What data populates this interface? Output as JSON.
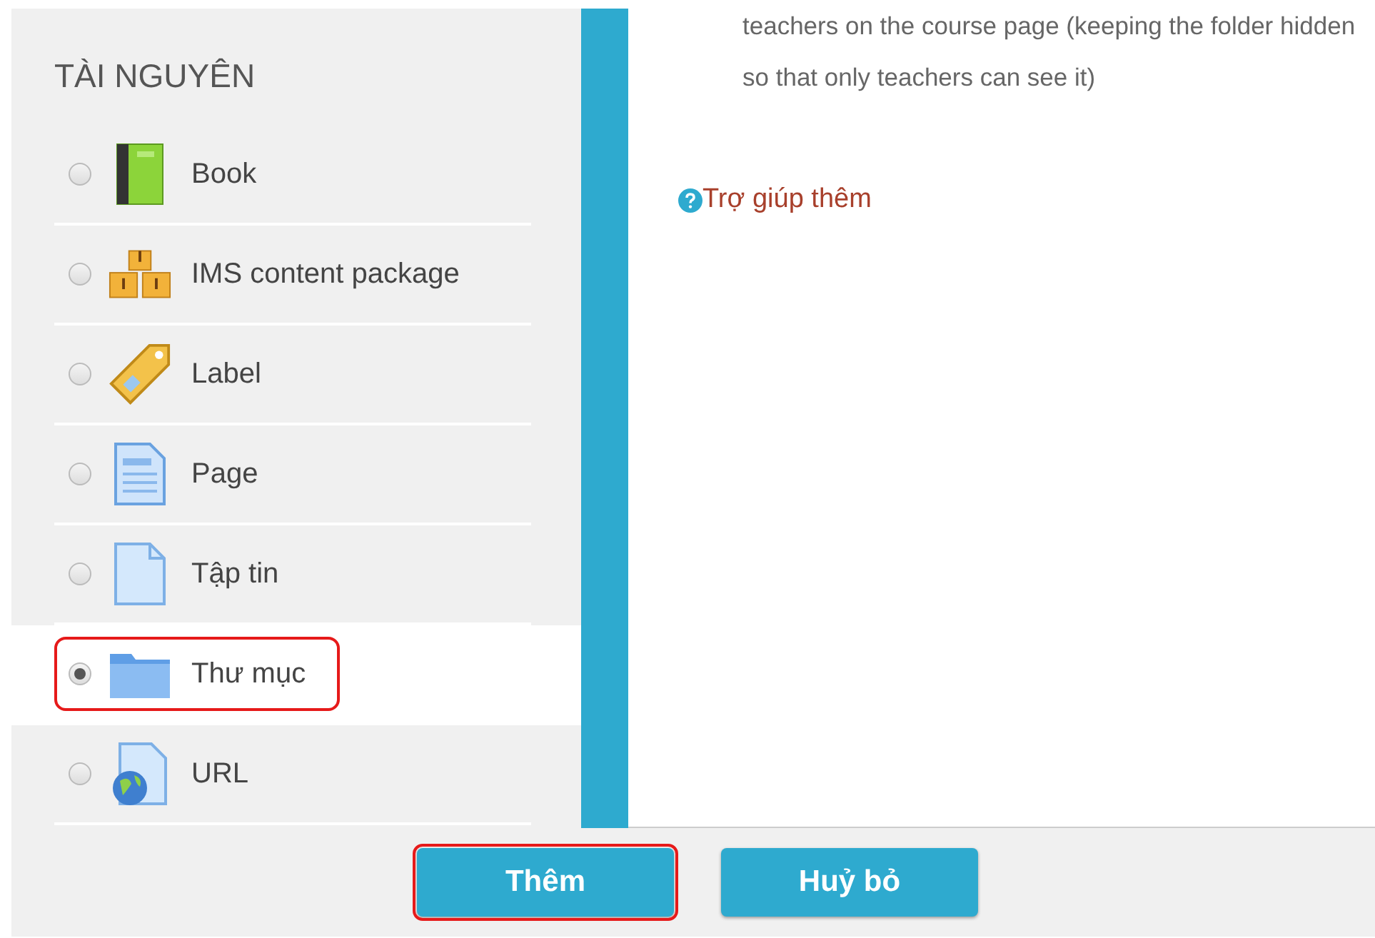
{
  "resources": {
    "heading": "TÀI NGUYÊN",
    "items": [
      {
        "kind": "book",
        "label": "Book",
        "selected": false,
        "highlighted": false
      },
      {
        "kind": "package",
        "label": "IMS content package",
        "selected": false,
        "highlighted": false
      },
      {
        "kind": "label",
        "label": "Label",
        "selected": false,
        "highlighted": false
      },
      {
        "kind": "page",
        "label": "Page",
        "selected": false,
        "highlighted": false
      },
      {
        "kind": "file",
        "label": "Tập tin",
        "selected": false,
        "highlighted": false
      },
      {
        "kind": "folder",
        "label": "Thư mục",
        "selected": true,
        "highlighted": true
      },
      {
        "kind": "url",
        "label": "URL",
        "selected": false,
        "highlighted": false
      }
    ]
  },
  "help": {
    "description": "teachers on the course page (keeping the folder hidden so that only teachers can see it)",
    "link": "Trợ giúp thêm"
  },
  "buttons": [
    {
      "label": "Thêm",
      "highlighted": true
    },
    {
      "label": "Huỷ bỏ",
      "highlighted": false
    }
  ]
}
